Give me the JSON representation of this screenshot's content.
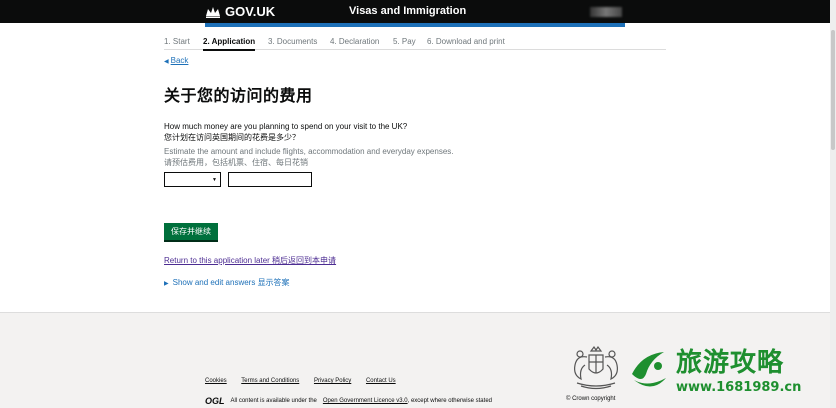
{
  "header": {
    "logo_text": "GOV.UK",
    "service_name": "Visas and Immigration"
  },
  "steps": [
    {
      "label": "1. Start"
    },
    {
      "label": "2. Application"
    },
    {
      "label": "3. Documents"
    },
    {
      "label": "4. Declaration"
    },
    {
      "label": "5. Pay"
    },
    {
      "label": "6. Download and print"
    }
  ],
  "nav": {
    "back_label": "Back"
  },
  "page": {
    "title": "关于您的访问的费用",
    "question_en": "How much money are you planning to spend on your visit to the UK?",
    "question_zh": "您计划在访问英国期间的花费是多少？",
    "hint_en": "Estimate the amount and include flights, accommodation and everyday expenses.",
    "hint_zh": "请预估费用，包括机票、住宿、每日花销"
  },
  "form": {
    "currency_value": "",
    "amount_value": "",
    "save_button": "保存并继续",
    "return_link": "Return to this application later 稍后返回到本申请",
    "show_answers": "Show and edit answers 显示答案"
  },
  "footer": {
    "links": [
      "Cookies",
      "Terms and Conditions",
      "Privacy Policy",
      "Contact Us"
    ],
    "licence_prefix": "All content is available under the",
    "licence_link": "Open Government Licence v3.0",
    "licence_suffix": ", except where otherwise stated",
    "copyright": "© Crown copyright",
    "ogl_logo": "OGL"
  },
  "watermark": {
    "title": "旅游攻略",
    "url": "www.1681989.cn"
  },
  "colors": {
    "header_bg": "#0b0c0c",
    "blue_bar": "#1d70b8",
    "button_green": "#00703c",
    "link_blue": "#1d70b8",
    "visited_link": "#4c2c92",
    "footer_bg": "#f3f2f1",
    "watermark_green": "#1e8f2f"
  },
  "icons": {
    "header_logo": "crown-icon",
    "back": "triangle-left-icon",
    "details": "triangle-right-icon",
    "select": "caret-down-icon",
    "footer_crest": "royal-coat-of-arms-icon",
    "watermark": "swoosh-logo-icon"
  }
}
